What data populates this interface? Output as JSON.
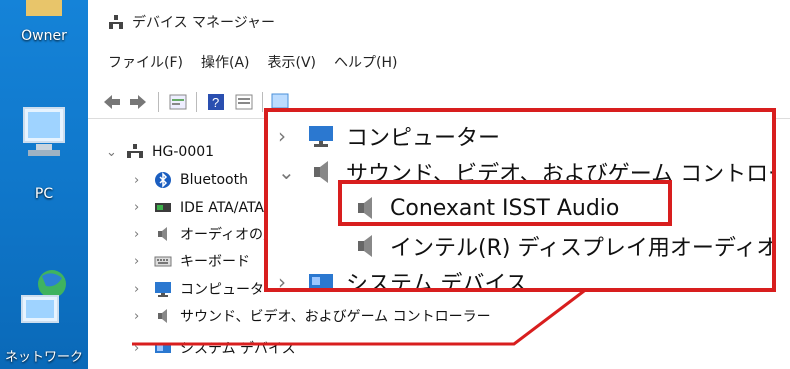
{
  "desktop": {
    "icons": [
      {
        "name": "owner-folder-icon",
        "label": "Owner"
      },
      {
        "name": "pc-icon",
        "label": "PC"
      },
      {
        "name": "network-icon",
        "label": "ネットワーク"
      }
    ]
  },
  "window": {
    "title": "デバイス マネージャー",
    "menu": [
      "ファイル(F)",
      "操作(A)",
      "表示(V)",
      "ヘルプ(H)"
    ]
  },
  "tree": {
    "root": "HG-0001",
    "items": [
      {
        "label": "Bluetooth",
        "icon": "bluetooth-icon"
      },
      {
        "label": "IDE ATA/ATAPI コントローラー",
        "icon": "ide-icon"
      },
      {
        "label": "オーディオの入力および出力",
        "icon": "speaker-icon"
      },
      {
        "label": "キーボード",
        "icon": "keyboard-icon"
      },
      {
        "label": "コンピューター",
        "icon": "monitor-icon"
      },
      {
        "label": "サウンド、ビデオ、およびゲーム コントローラー",
        "icon": "speaker-icon"
      },
      {
        "label": "システム デバイス",
        "icon": "system-device-icon"
      }
    ]
  },
  "zoom": {
    "rows": [
      {
        "label": "コンピューター",
        "icon": "monitor-icon"
      },
      {
        "label": "サウンド、ビデオ、およびゲーム コントローラー",
        "icon": "speaker-icon"
      },
      {
        "label": "Conexant ISST Audio",
        "icon": "speaker-icon"
      },
      {
        "label": "インテル(R) ディスプレイ用オーディオ",
        "icon": "speaker-icon"
      },
      {
        "label": "システム デバイス",
        "icon": "system-device-icon"
      }
    ]
  },
  "colors": {
    "annotation": "#d81e1e",
    "desktop": "#1583d8"
  }
}
